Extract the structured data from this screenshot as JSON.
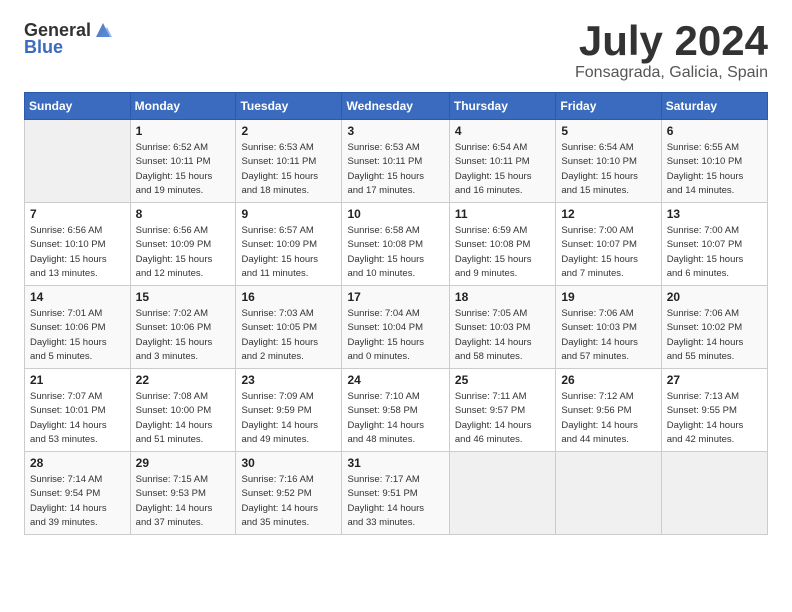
{
  "logo": {
    "text_general": "General",
    "text_blue": "Blue"
  },
  "title": "July 2024",
  "subtitle": "Fonsagrada, Galicia, Spain",
  "weekdays": [
    "Sunday",
    "Monday",
    "Tuesday",
    "Wednesday",
    "Thursday",
    "Friday",
    "Saturday"
  ],
  "weeks": [
    [
      {
        "day": "",
        "info": ""
      },
      {
        "day": "1",
        "info": "Sunrise: 6:52 AM\nSunset: 10:11 PM\nDaylight: 15 hours\nand 19 minutes."
      },
      {
        "day": "2",
        "info": "Sunrise: 6:53 AM\nSunset: 10:11 PM\nDaylight: 15 hours\nand 18 minutes."
      },
      {
        "day": "3",
        "info": "Sunrise: 6:53 AM\nSunset: 10:11 PM\nDaylight: 15 hours\nand 17 minutes."
      },
      {
        "day": "4",
        "info": "Sunrise: 6:54 AM\nSunset: 10:11 PM\nDaylight: 15 hours\nand 16 minutes."
      },
      {
        "day": "5",
        "info": "Sunrise: 6:54 AM\nSunset: 10:10 PM\nDaylight: 15 hours\nand 15 minutes."
      },
      {
        "day": "6",
        "info": "Sunrise: 6:55 AM\nSunset: 10:10 PM\nDaylight: 15 hours\nand 14 minutes."
      }
    ],
    [
      {
        "day": "7",
        "info": "Sunrise: 6:56 AM\nSunset: 10:10 PM\nDaylight: 15 hours\nand 13 minutes."
      },
      {
        "day": "8",
        "info": "Sunrise: 6:56 AM\nSunset: 10:09 PM\nDaylight: 15 hours\nand 12 minutes."
      },
      {
        "day": "9",
        "info": "Sunrise: 6:57 AM\nSunset: 10:09 PM\nDaylight: 15 hours\nand 11 minutes."
      },
      {
        "day": "10",
        "info": "Sunrise: 6:58 AM\nSunset: 10:08 PM\nDaylight: 15 hours\nand 10 minutes."
      },
      {
        "day": "11",
        "info": "Sunrise: 6:59 AM\nSunset: 10:08 PM\nDaylight: 15 hours\nand 9 minutes."
      },
      {
        "day": "12",
        "info": "Sunrise: 7:00 AM\nSunset: 10:07 PM\nDaylight: 15 hours\nand 7 minutes."
      },
      {
        "day": "13",
        "info": "Sunrise: 7:00 AM\nSunset: 10:07 PM\nDaylight: 15 hours\nand 6 minutes."
      }
    ],
    [
      {
        "day": "14",
        "info": "Sunrise: 7:01 AM\nSunset: 10:06 PM\nDaylight: 15 hours\nand 5 minutes."
      },
      {
        "day": "15",
        "info": "Sunrise: 7:02 AM\nSunset: 10:06 PM\nDaylight: 15 hours\nand 3 minutes."
      },
      {
        "day": "16",
        "info": "Sunrise: 7:03 AM\nSunset: 10:05 PM\nDaylight: 15 hours\nand 2 minutes."
      },
      {
        "day": "17",
        "info": "Sunrise: 7:04 AM\nSunset: 10:04 PM\nDaylight: 15 hours\nand 0 minutes."
      },
      {
        "day": "18",
        "info": "Sunrise: 7:05 AM\nSunset: 10:03 PM\nDaylight: 14 hours\nand 58 minutes."
      },
      {
        "day": "19",
        "info": "Sunrise: 7:06 AM\nSunset: 10:03 PM\nDaylight: 14 hours\nand 57 minutes."
      },
      {
        "day": "20",
        "info": "Sunrise: 7:06 AM\nSunset: 10:02 PM\nDaylight: 14 hours\nand 55 minutes."
      }
    ],
    [
      {
        "day": "21",
        "info": "Sunrise: 7:07 AM\nSunset: 10:01 PM\nDaylight: 14 hours\nand 53 minutes."
      },
      {
        "day": "22",
        "info": "Sunrise: 7:08 AM\nSunset: 10:00 PM\nDaylight: 14 hours\nand 51 minutes."
      },
      {
        "day": "23",
        "info": "Sunrise: 7:09 AM\nSunset: 9:59 PM\nDaylight: 14 hours\nand 49 minutes."
      },
      {
        "day": "24",
        "info": "Sunrise: 7:10 AM\nSunset: 9:58 PM\nDaylight: 14 hours\nand 48 minutes."
      },
      {
        "day": "25",
        "info": "Sunrise: 7:11 AM\nSunset: 9:57 PM\nDaylight: 14 hours\nand 46 minutes."
      },
      {
        "day": "26",
        "info": "Sunrise: 7:12 AM\nSunset: 9:56 PM\nDaylight: 14 hours\nand 44 minutes."
      },
      {
        "day": "27",
        "info": "Sunrise: 7:13 AM\nSunset: 9:55 PM\nDaylight: 14 hours\nand 42 minutes."
      }
    ],
    [
      {
        "day": "28",
        "info": "Sunrise: 7:14 AM\nSunset: 9:54 PM\nDaylight: 14 hours\nand 39 minutes."
      },
      {
        "day": "29",
        "info": "Sunrise: 7:15 AM\nSunset: 9:53 PM\nDaylight: 14 hours\nand 37 minutes."
      },
      {
        "day": "30",
        "info": "Sunrise: 7:16 AM\nSunset: 9:52 PM\nDaylight: 14 hours\nand 35 minutes."
      },
      {
        "day": "31",
        "info": "Sunrise: 7:17 AM\nSunset: 9:51 PM\nDaylight: 14 hours\nand 33 minutes."
      },
      {
        "day": "",
        "info": ""
      },
      {
        "day": "",
        "info": ""
      },
      {
        "day": "",
        "info": ""
      }
    ]
  ]
}
